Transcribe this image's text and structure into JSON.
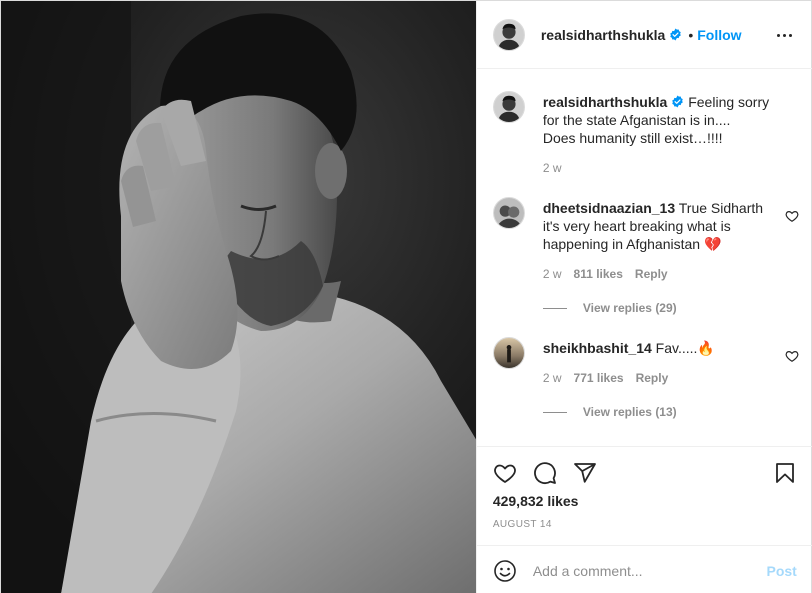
{
  "colors": {
    "accent": "#0095f6",
    "secondary_text": "#8e8e8e",
    "primary_text": "#262626",
    "like_red": "#ed4956"
  },
  "photo": {
    "alt_icon": "photo-bw-man-resting-head-on-hand"
  },
  "header": {
    "username": "realsidharthshukla",
    "verified_icon": "verified-badge-icon",
    "separator": "•",
    "follow_label": "Follow",
    "more_icon": "more-options-icon"
  },
  "caption": {
    "username": "realsidharthshukla",
    "text_line1": " Feeling sorry for the state Afganistan is in....",
    "text_line2": "Does humanity still exist…!!!!",
    "time": "2 w"
  },
  "comments": [
    {
      "username": "dheetsidnaazian_13",
      "text": " True Sidharth it's very heart breaking what is happening in Afghanistan 💔",
      "time": "2 w",
      "likes": "811 likes",
      "reply_label": "Reply",
      "view_replies": "View replies (29)"
    },
    {
      "username": "sheikhbashit_14",
      "text": " Fav.....🔥",
      "time": "2 w",
      "likes": "771 likes",
      "reply_label": "Reply",
      "view_replies": "View replies (13)"
    }
  ],
  "actions": {
    "like_icon": "heart-icon",
    "comment_icon": "comment-icon",
    "share_icon": "share-paper-plane-icon",
    "save_icon": "bookmark-icon",
    "likes": "429,832 likes",
    "date": "AUGUST 14"
  },
  "add_comment": {
    "emoji_icon": "emoji-smiley-icon",
    "placeholder": "Add a comment...",
    "post_label": "Post"
  }
}
